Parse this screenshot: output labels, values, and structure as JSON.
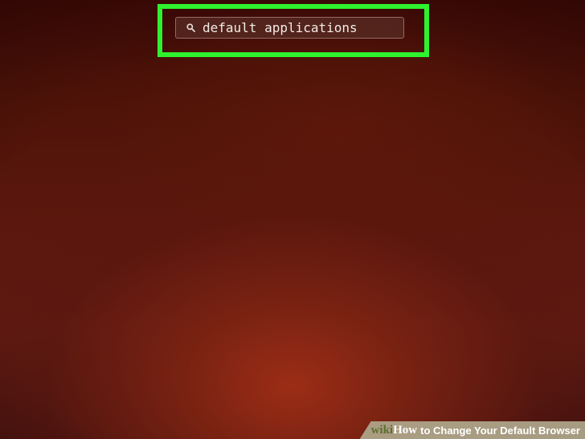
{
  "search": {
    "value": "default applications",
    "icon": "search-icon"
  },
  "highlight": {
    "color": "#2ef22e"
  },
  "watermark": {
    "brand_wiki": "wiki",
    "brand_how": "How",
    "title": "to Change Your Default Browser"
  },
  "colors": {
    "background": "#5b170d",
    "accent": "#2ef22e"
  }
}
